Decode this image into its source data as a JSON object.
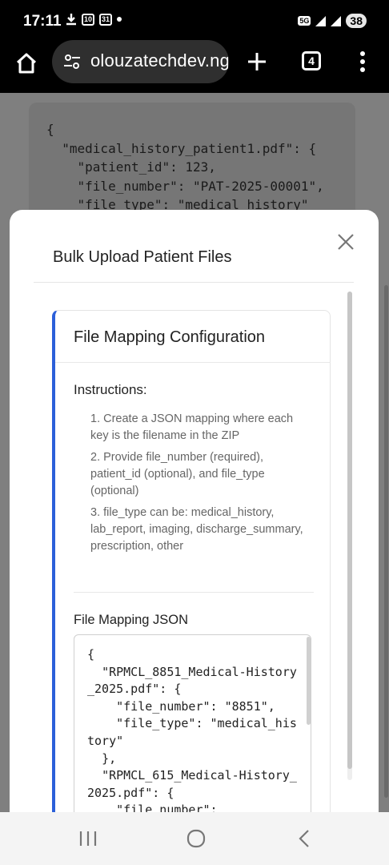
{
  "status_bar": {
    "time": "17:11",
    "left_icons": [
      "download-icon",
      "calendar-icon",
      "calendar-icon",
      "dot"
    ],
    "badge_10": "10",
    "badge_31": "31",
    "network": "5G",
    "battery": "38"
  },
  "browser": {
    "url": "olouzatechdev.ng",
    "tab_count": "4"
  },
  "background_page": {
    "code": "{\n  \"medical_history_patient1.pdf\": {\n    \"patient_id\": 123,\n    \"file_number\": \"PAT-2025-00001\",\n    \"file_type\": \"medical_history\""
  },
  "modal": {
    "title": "Bulk Upload Patient Files",
    "card": {
      "title": "File Mapping Configuration",
      "instructions_title": "Instructions:",
      "instructions": [
        "1. Create a JSON mapping where each key is the filename in the ZIP",
        "2. Provide file_number (required), patient_id (optional), and file_type (optional)",
        "3. file_type can be: medical_history, lab_report, imaging, discharge_summary, prescription, other"
      ],
      "json_label": "File Mapping JSON",
      "json_value": "{\n  \"RPMCL_8851_Medical-History_2025.pdf\": {\n    \"file_number\": \"8851\",\n    \"file_type\": \"medical_history\"\n  },\n  \"RPMCL_615_Medical-History_2025.pdf\": {\n    \"file_number\":"
    }
  },
  "colors": {
    "accent": "#2b5fd9",
    "overlay": "#7f7f7f"
  }
}
